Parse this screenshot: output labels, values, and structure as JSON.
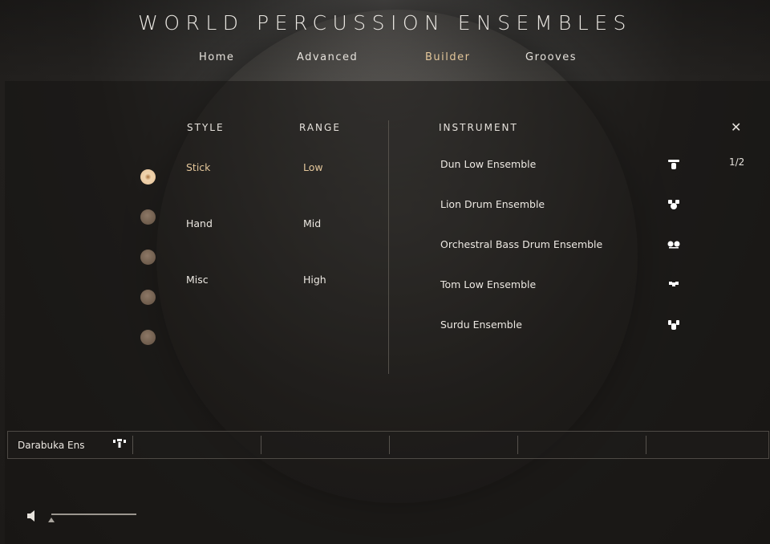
{
  "app": {
    "title": "WORLD PERCUSSION ENSEMBLES"
  },
  "nav": {
    "items": [
      {
        "label": "Home"
      },
      {
        "label": "Advanced"
      },
      {
        "label": "Builder"
      },
      {
        "label": "Grooves"
      }
    ],
    "active": "Builder"
  },
  "builder": {
    "style_header": "STYLE",
    "range_header": "RANGE",
    "instrument_header": "INSTRUMENT",
    "styles": [
      "Stick",
      "Hand",
      "Misc"
    ],
    "ranges": [
      "Low",
      "Mid",
      "High"
    ],
    "selected_style": "Stick",
    "selected_range": "Low",
    "slot_count": 5,
    "active_slot": 1,
    "instruments": [
      {
        "name": "Dun Low Ensemble",
        "icon": "drum-ensemble-icon"
      },
      {
        "name": "Lion Drum Ensemble",
        "icon": "drum-ensemble-icon"
      },
      {
        "name": "Orchestral Bass Drum Ensemble",
        "icon": "drum-ensemble-icon"
      },
      {
        "name": "Tom Low Ensemble",
        "icon": "drum-ensemble-icon"
      },
      {
        "name": "Surdu Ensemble",
        "icon": "drum-ensemble-icon"
      }
    ],
    "pager": "1/2",
    "close_icon": "close-icon"
  },
  "slots": {
    "first": {
      "name": "Darabuka Ens",
      "icon": "drum-ensemble-icon"
    },
    "count": 6
  },
  "volume": {
    "icon": "speaker-icon",
    "level": 0
  },
  "colors": {
    "accent": "#e3c69a",
    "text": "#e6e2dc",
    "background": "#1c1a18"
  }
}
